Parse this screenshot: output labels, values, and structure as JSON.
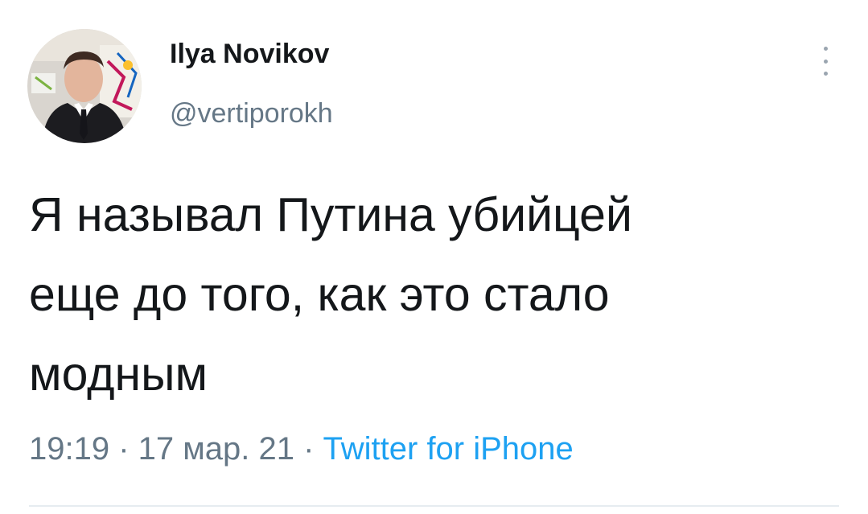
{
  "author": {
    "display_name": "Ilya Novikov",
    "handle": "@vertiporokh"
  },
  "icons": {
    "avatar": "profile-photo",
    "more": "vertical-dots-icon"
  },
  "tweet": {
    "text": "Я называл Путина убийцей\nеще до того, как это стало\nмодным",
    "time": "19:19",
    "separator_1": " · ",
    "date": "17 мар. 21",
    "separator_2": " · ",
    "source": "Twitter for iPhone"
  },
  "colors": {
    "text": "#14171a",
    "secondary": "#657786",
    "link": "#1da1f2",
    "divider": "#e6ecf0"
  }
}
